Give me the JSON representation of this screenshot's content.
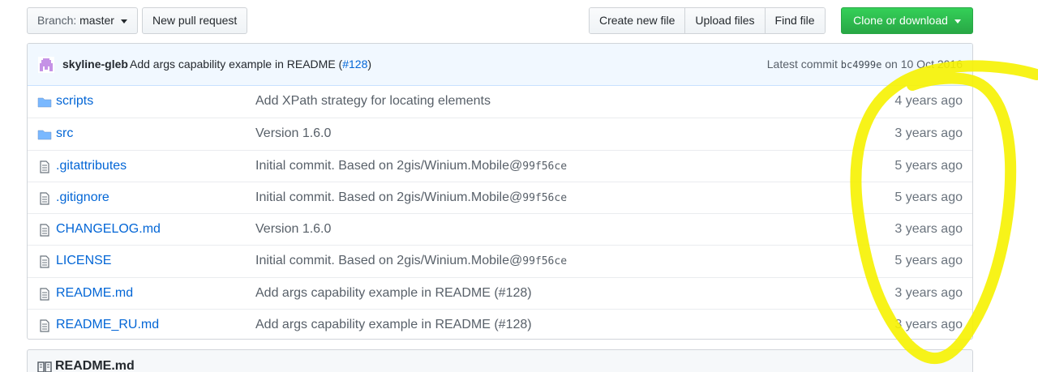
{
  "toolbar": {
    "branch_prefix": "Branch:",
    "branch_name": "master",
    "new_pr": "New pull request",
    "create_file": "Create new file",
    "upload_files": "Upload files",
    "find_file": "Find file",
    "clone": "Clone or download"
  },
  "commit": {
    "author": "skyline-gleb",
    "message": "Add args capability example in README (",
    "pr_link": "#128",
    "message_end": ")",
    "latest_label": "Latest commit",
    "sha": "bc4999e",
    "date": "on 10 Oct 2016"
  },
  "files": [
    {
      "name": "scripts",
      "type": "folder",
      "msg": "Add XPath strategy for locating elements",
      "sha": "",
      "age": "4 years ago"
    },
    {
      "name": "src",
      "type": "folder",
      "msg": "Version 1.6.0",
      "sha": "",
      "age": "3 years ago"
    },
    {
      "name": ".gitattributes",
      "type": "file",
      "msg": "Initial commit. Based on 2gis/Winium.Mobile@",
      "sha": "99f56ce",
      "age": "5 years ago"
    },
    {
      "name": ".gitignore",
      "type": "file",
      "msg": "Initial commit. Based on 2gis/Winium.Mobile@",
      "sha": "99f56ce",
      "age": "5 years ago"
    },
    {
      "name": "CHANGELOG.md",
      "type": "file",
      "msg": "Version 1.6.0",
      "sha": "",
      "age": "3 years ago"
    },
    {
      "name": "LICENSE",
      "type": "file",
      "msg": "Initial commit. Based on 2gis/Winium.Mobile@",
      "sha": "99f56ce",
      "age": "5 years ago"
    },
    {
      "name": "README.md",
      "type": "file",
      "msg": "Add args capability example in README (#128)",
      "sha": "",
      "age": "3 years ago"
    },
    {
      "name": "README_RU.md",
      "type": "file",
      "msg": "Add args capability example in README (#128)",
      "sha": "",
      "age": "3 years ago"
    }
  ],
  "readme": {
    "title": "README.md"
  },
  "colors": {
    "accent": "#0366d6",
    "green": "#28a745",
    "highlighter": "#f6f200"
  }
}
